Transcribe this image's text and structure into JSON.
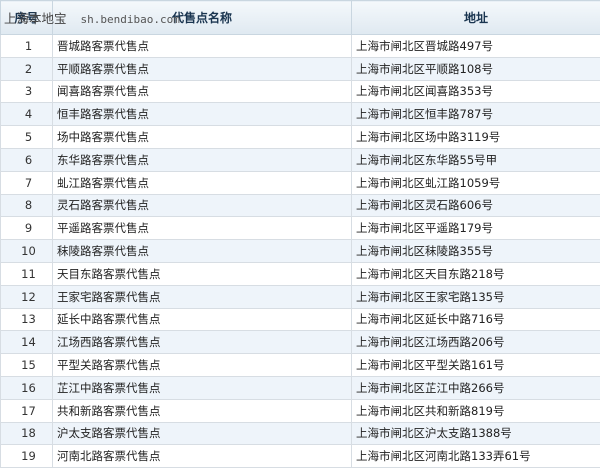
{
  "watermark": {
    "site": "上海本地宝",
    "url": "sh.bendibao.com"
  },
  "table": {
    "headers": {
      "no": "序号",
      "name": "代售点名称",
      "address": "地址"
    },
    "rows": [
      {
        "no": "1",
        "name": "晋城路客票代售点",
        "address": "上海市闸北区晋城路497号"
      },
      {
        "no": "2",
        "name": "平顺路客票代售点",
        "address": "上海市闸北区平顺路108号"
      },
      {
        "no": "3",
        "name": "闻喜路客票代售点",
        "address": "上海市闸北区闻喜路353号"
      },
      {
        "no": "4",
        "name": "恒丰路客票代售点",
        "address": "上海市闸北区恒丰路787号"
      },
      {
        "no": "5",
        "name": "场中路客票代售点",
        "address": "上海市闸北区场中路3119号"
      },
      {
        "no": "6",
        "name": "东华路客票代售点",
        "address": "上海市闸北区东华路55号甲"
      },
      {
        "no": "7",
        "name": "虬江路客票代售点",
        "address": "上海市闸北区虬江路1059号"
      },
      {
        "no": "8",
        "name": "灵石路客票代售点",
        "address": "上海市闸北区灵石路606号"
      },
      {
        "no": "9",
        "name": "平遥路客票代售点",
        "address": "上海市闸北区平遥路179号"
      },
      {
        "no": "10",
        "name": "秣陵路客票代售点",
        "address": "上海市闸北区秣陵路355号"
      },
      {
        "no": "11",
        "name": "天目东路客票代售点",
        "address": "上海市闸北区天目东路218号"
      },
      {
        "no": "12",
        "name": "王家宅路客票代售点",
        "address": "上海市闸北区王家宅路135号"
      },
      {
        "no": "13",
        "name": "延长中路客票代售点",
        "address": "上海市闸北区延长中路716号"
      },
      {
        "no": "14",
        "name": "江场西路客票代售点",
        "address": "上海市闸北区江场西路206号"
      },
      {
        "no": "15",
        "name": "平型关路客票代售点",
        "address": "上海市闸北区平型关路161号"
      },
      {
        "no": "16",
        "name": "芷江中路客票代售点",
        "address": "上海市闸北区芷江中路266号"
      },
      {
        "no": "17",
        "name": "共和新路客票代售点",
        "address": "上海市闸北区共和新路819号"
      },
      {
        "no": "18",
        "name": "沪太支路客票代售点",
        "address": "上海市闸北区沪太支路1388号"
      },
      {
        "no": "19",
        "name": "河南北路客票代售点",
        "address": "上海市闸北区河南北路133弄61号"
      }
    ]
  }
}
